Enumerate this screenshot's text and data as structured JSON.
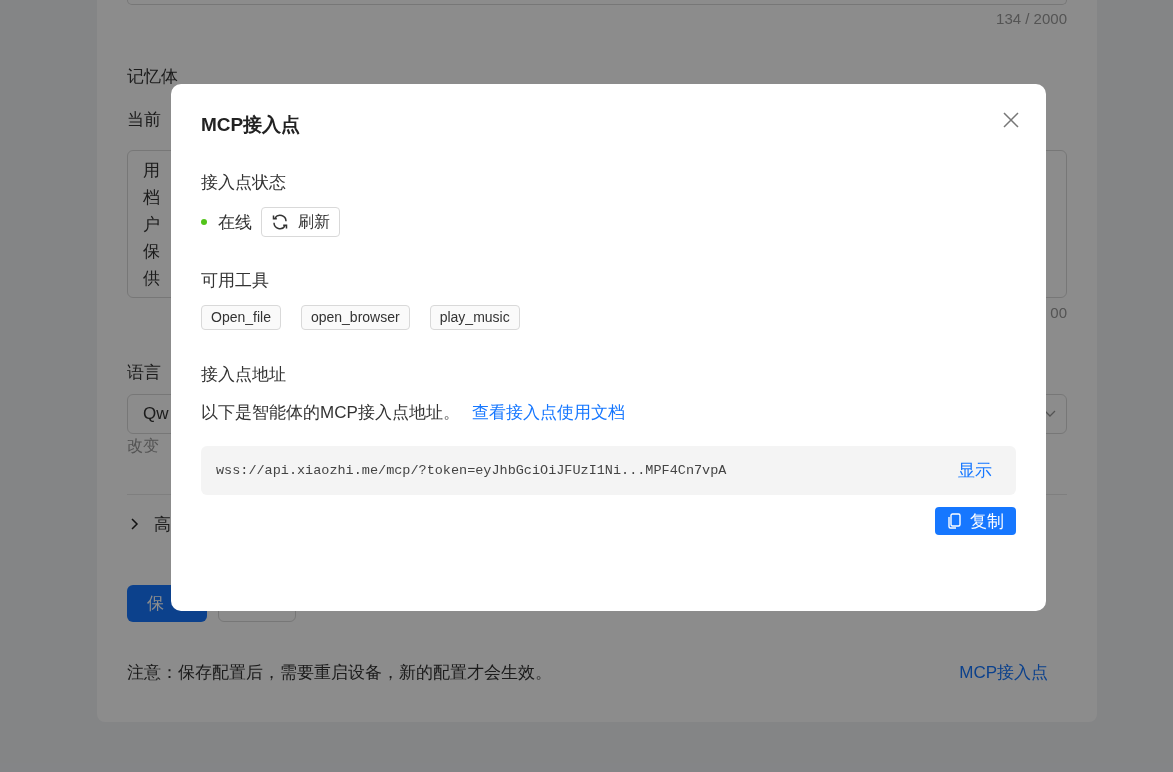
{
  "background": {
    "field_counter": "134 / 2000",
    "memory_label": "记忆体",
    "current_label": "当前",
    "textarea_lines": [
      "用",
      "档",
      "户",
      "保",
      "供"
    ],
    "textarea_counter": "00",
    "language_label": "语言",
    "select_value": "Qw",
    "language_hint": "改变",
    "advanced_label": "高",
    "save_button": "保",
    "note": "注意：保存配置后，需要重启设备，新的配置才会生效。",
    "mcp_link": "MCP接入点"
  },
  "modal": {
    "title": "MCP接入点",
    "status_heading": "接入点状态",
    "status": {
      "online": true,
      "label": "在线"
    },
    "refresh_button": "刷新",
    "tools_heading": "可用工具",
    "tools": [
      "Open_file",
      "open_browser",
      "play_music"
    ],
    "address_heading": "接入点地址",
    "description": "以下是智能体的MCP接入点地址。",
    "docs_link": "查看接入点使用文档",
    "url": "wss://api.xiaozhi.me/mcp/?token=eyJhbGciOiJFUzI1Ni...MPF4Cn7vpA",
    "show_button": "显示",
    "copy_button": "复制"
  }
}
